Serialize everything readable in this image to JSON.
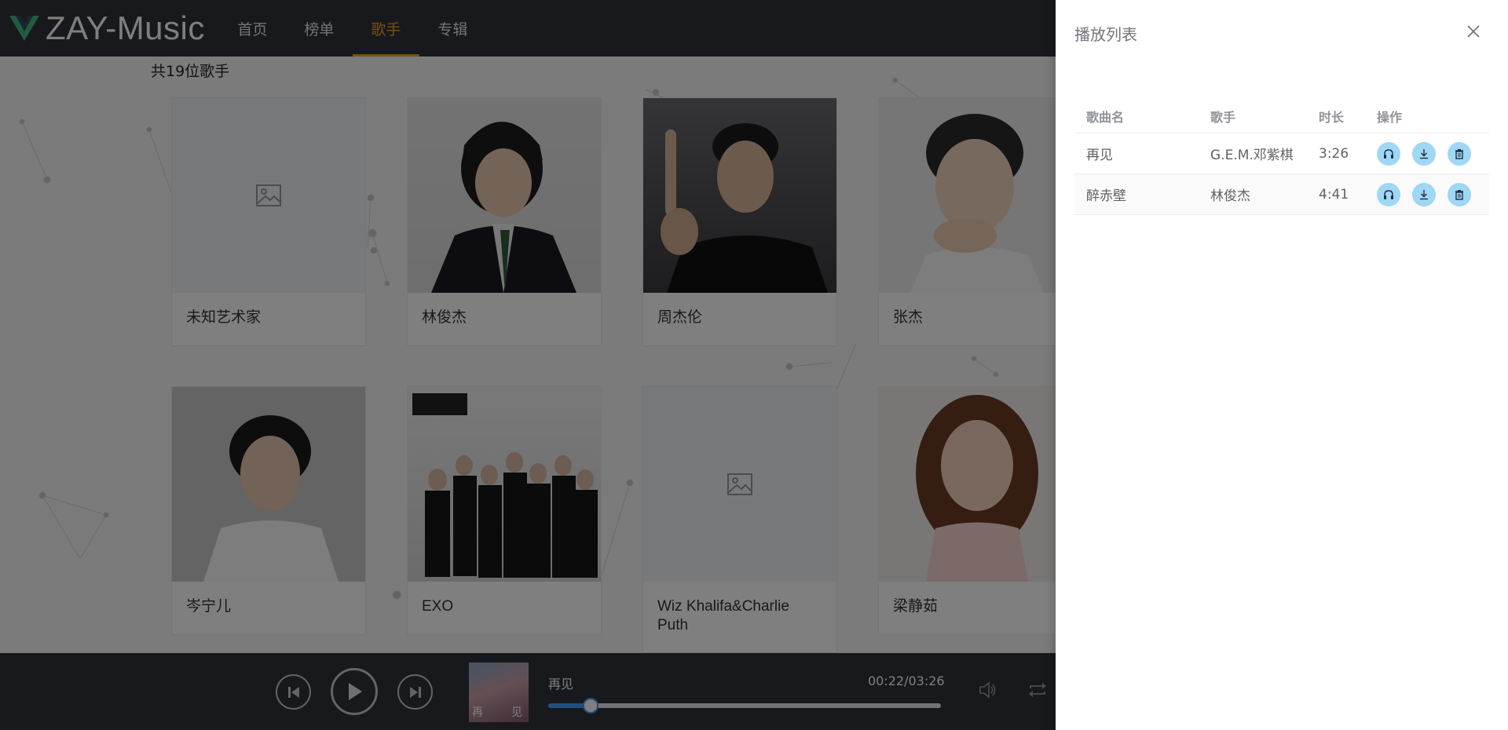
{
  "app": {
    "logo_text": "ZAY-Music",
    "brand_color": "#41b883",
    "accent_color": "#f0a020"
  },
  "nav": {
    "items": [
      {
        "label": "首页",
        "active": false
      },
      {
        "label": "榜单",
        "active": false
      },
      {
        "label": "歌手",
        "active": true
      },
      {
        "label": "专辑",
        "active": false
      }
    ]
  },
  "singers": {
    "count_label": "共19位歌手",
    "cards": [
      {
        "name": "未知艺术家",
        "image": "placeholder-icon"
      },
      {
        "name": "林俊杰",
        "image": "portrait-photo"
      },
      {
        "name": "周杰伦",
        "image": "portrait-photo"
      },
      {
        "name": "张杰",
        "image": "portrait-photo"
      },
      {
        "name": "岑宁儿",
        "image": "portrait-photo"
      },
      {
        "name": "EXO",
        "image": "group-photo"
      },
      {
        "name": "Wiz Khalifa&Charlie Puth",
        "image": "placeholder-icon"
      },
      {
        "name": "梁静茹",
        "image": "portrait-photo"
      }
    ]
  },
  "player": {
    "title": "再见",
    "time": "00:22/03:26",
    "progress": 0.107,
    "cover_text_left": "再",
    "cover_text_right": "见",
    "icons": [
      "prev-icon",
      "play-icon",
      "next-icon",
      "volume-icon",
      "loop-icon"
    ]
  },
  "playlist": {
    "title": "播放列表",
    "columns": [
      "歌曲名",
      "歌手",
      "时长",
      "操作"
    ],
    "rows": [
      {
        "song": "再见",
        "singer": "G.E.M.邓紫棋",
        "duration": "3:26"
      },
      {
        "song": "醉赤壁",
        "singer": "林俊杰",
        "duration": "4:41"
      }
    ],
    "op_icons": [
      "headphones-icon",
      "download-icon",
      "trash-icon"
    ]
  }
}
